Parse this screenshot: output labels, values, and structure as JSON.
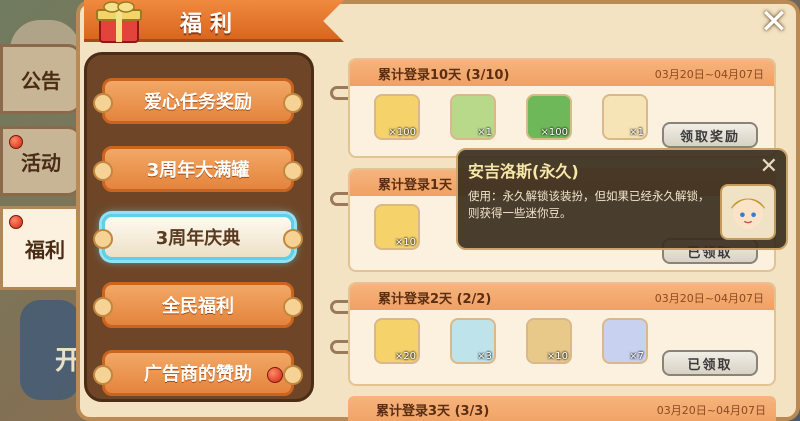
{
  "background": {
    "text": "开"
  },
  "side_tabs": [
    {
      "label": "公告",
      "dot": false
    },
    {
      "label": "活动",
      "dot": true
    },
    {
      "label": "福利",
      "dot": true,
      "active": true
    }
  ],
  "header": {
    "title": "福利"
  },
  "menu": [
    {
      "label": "爱心任务奖励",
      "active": false,
      "dot": false
    },
    {
      "label": "3周年大满罐",
      "active": false,
      "dot": false
    },
    {
      "label": "3周年庆典",
      "active": true,
      "dot": false
    },
    {
      "label": "全民福利",
      "active": false,
      "dot": false
    },
    {
      "label": "广告商的赞助",
      "active": false,
      "dot": true
    }
  ],
  "cards": [
    {
      "title": "累计登录10天 (3/10)",
      "date": "03月20日~04月07日",
      "items": [
        {
          "icon": "gold-ticket-icon",
          "count": "×100"
        },
        {
          "icon": "photo-frame-icon",
          "count": "×1"
        },
        {
          "icon": "green-gem-icon",
          "count": "×100"
        },
        {
          "icon": "character-portrait-icon",
          "count": "×1"
        }
      ],
      "button": "领取奖励"
    },
    {
      "title": "累计登录1天",
      "date": "",
      "items": [
        {
          "icon": "gold-ticket-icon",
          "count": "×10"
        }
      ],
      "button": "已领取"
    },
    {
      "title": "累计登录2天 (2/2)",
      "date": "03月20日~04月07日",
      "items": [
        {
          "icon": "gold-ticket-icon",
          "count": "×20"
        },
        {
          "icon": "ice-cream-icon",
          "count": "×3"
        },
        {
          "icon": "goggles-character-icon",
          "count": "×10"
        },
        {
          "icon": "robot-head-icon",
          "count": "×7"
        }
      ],
      "button": "已领取"
    },
    {
      "title": "累计登录3天 (3/3)",
      "date": "03月20日~04月07日"
    }
  ],
  "tooltip": {
    "name": "安吉洛斯(永久)",
    "description": "使用：永久解锁该装扮，但如果已经永久解锁，则获得一些迷你豆。"
  },
  "colors": {
    "accent": "#e4843e",
    "frame": "#b98a53",
    "active_glow": "#8fe3f5",
    "dot": "#d0240e"
  }
}
